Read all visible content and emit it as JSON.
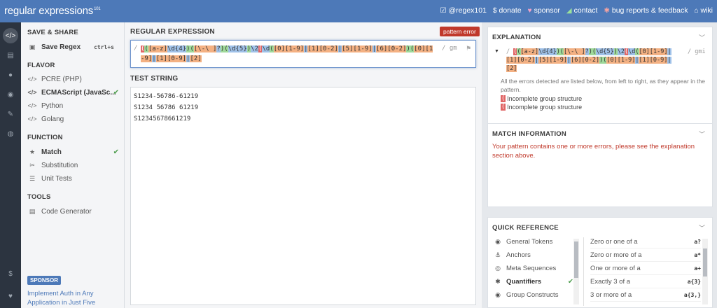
{
  "topbar": {
    "logo": "regular expressions",
    "logo_sup": "101",
    "links": [
      {
        "icon": "twitter-icon",
        "glyph": "☑",
        "label": "@regex101"
      },
      {
        "icon": "dollar-icon",
        "glyph": "$",
        "label": "donate"
      },
      {
        "icon": "heart-icon",
        "glyph": "♥",
        "label": "sponsor"
      },
      {
        "icon": "send-icon",
        "glyph": "◢",
        "label": "contact"
      },
      {
        "icon": "bug-icon",
        "glyph": "✱",
        "label": "bug reports & feedback"
      },
      {
        "icon": "library-icon",
        "glyph": "⌂",
        "label": "wiki"
      }
    ]
  },
  "sidebar": {
    "save_share_title": "SAVE & SHARE",
    "save_regex": "Save Regex",
    "save_shortcut": "ctrl+s",
    "flavor_title": "FLAVOR",
    "flavors": [
      "PCRE (PHP)",
      "ECMAScript (JavaSc...",
      "Python",
      "Golang"
    ],
    "function_title": "FUNCTION",
    "functions": [
      "Match",
      "Substitution",
      "Unit Tests"
    ],
    "tools_title": "TOOLS",
    "code_generator": "Code Generator",
    "sponsor_badge": "SPONSOR",
    "sponsor_text": "Implement Auth in Any Application in Just Five Minutes."
  },
  "center": {
    "regex_title": "REGULAR EXPRESSION",
    "error_badge": "pattern error",
    "delimiter": "/",
    "flags": "/ gm",
    "test_title": "TEST STRING",
    "test_lines": [
      "S1234-56786-61219",
      "S1234 56786 61219",
      "S12345678661219"
    ]
  },
  "explanation": {
    "title": "EXPLANATION",
    "flags": "/ gmi",
    "note": "All the errors detected are listed below, from left to right, as they appear in the pattern.",
    "errors": [
      "Incomplete group structure",
      "Incomplete group structure"
    ],
    "error_glyph": "("
  },
  "match_info": {
    "title": "MATCH INFORMATION",
    "message": "Your pattern contains one or more errors, please see the explanation section above."
  },
  "quick_reference": {
    "title": "QUICK REFERENCE",
    "categories": [
      "General Tokens",
      "Anchors",
      "Meta Sequences",
      "Quantifiers",
      "Group Constructs"
    ],
    "rows": [
      {
        "label": "Zero or one of a",
        "token": "a?"
      },
      {
        "label": "Zero or more of a",
        "token": "a*"
      },
      {
        "label": "One or more of a",
        "token": "a+"
      },
      {
        "label": "Exactly 3 of a",
        "token": "a{3}"
      },
      {
        "label": "3 or more of a",
        "token": "a{3,}"
      }
    ]
  },
  "colors": {
    "accent": "#4d79b8",
    "error": "#c0392b",
    "group": "#9fd99a",
    "escape": "#9fc1e8",
    "class": "#f4b183"
  }
}
